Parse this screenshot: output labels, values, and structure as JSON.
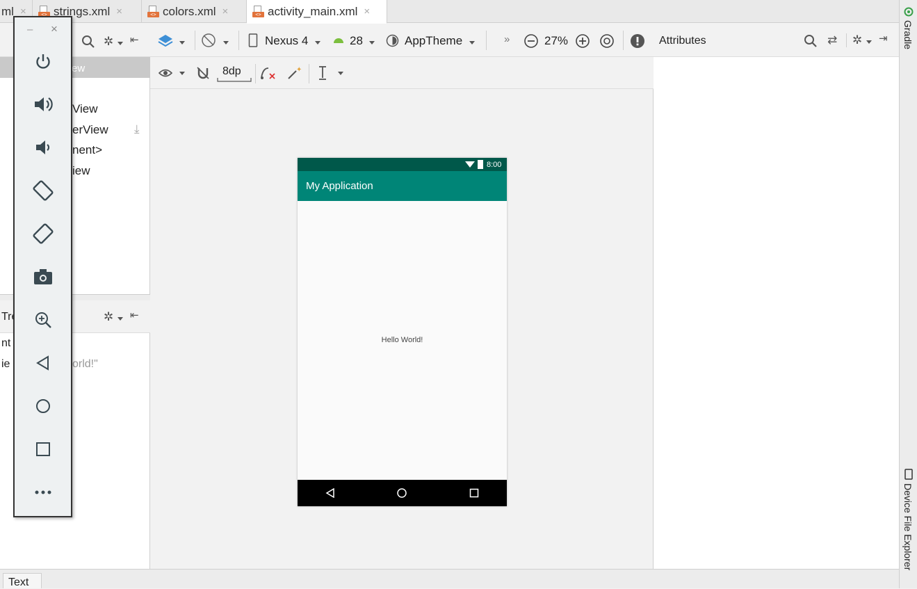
{
  "tabs": [
    {
      "label": "ml",
      "icon": "xml-file-icon",
      "active": false
    },
    {
      "label": "strings.xml",
      "icon": "xml-file-icon",
      "active": false
    },
    {
      "label": "colors.xml",
      "icon": "xml-file-icon",
      "active": false
    },
    {
      "label": "activity_main.xml",
      "icon": "xml-file-icon",
      "active": true
    }
  ],
  "tab_close_glyph": "×",
  "right_stripe": {
    "gradle": "Gradle",
    "device_file_explorer": "Device File Explorer"
  },
  "palette": {
    "selected_item": "ew",
    "items": [
      "View",
      "erView",
      "nent>",
      "iew"
    ]
  },
  "component_tree": {
    "label": "Tre",
    "rows": [
      "nt",
      "ie"
    ],
    "hello_value": "orld!\""
  },
  "design_toolbar": {
    "device": "Nexus 4",
    "api": "28",
    "theme": "AppTheme",
    "overflow": "»",
    "zoom": "27%",
    "margin": "8dp"
  },
  "phone": {
    "time": "8:00",
    "app_title": "My Application",
    "hello_text": "Hello World!",
    "colors": {
      "status_bar": "#00584a",
      "app_bar": "#008577",
      "nav_bar": "#000000"
    }
  },
  "attributes": {
    "title": "Attributes"
  },
  "bottom": {
    "text_tab": "Text"
  },
  "emulator_controls": [
    "power-icon",
    "volume-up-icon",
    "volume-down-icon",
    "rotate-left-icon",
    "rotate-right-icon",
    "camera-icon",
    "zoom-icon",
    "back-icon",
    "home-icon",
    "overview-icon",
    "more-icon"
  ],
  "emulator_window": {
    "minimize": "–",
    "close": "×"
  }
}
